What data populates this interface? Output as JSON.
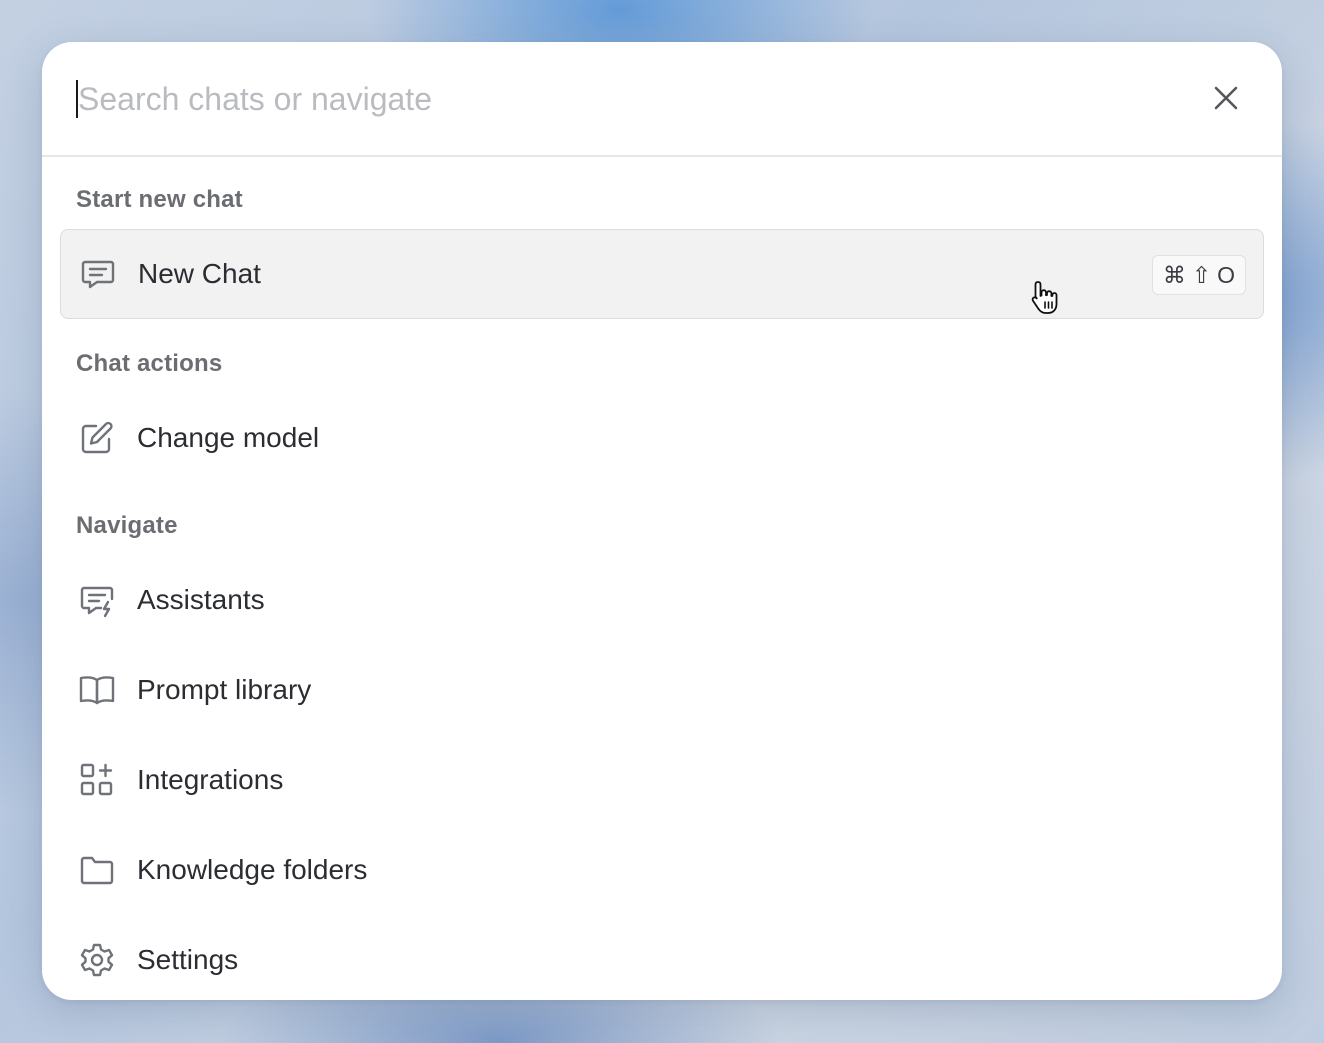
{
  "search": {
    "placeholder": "Search chats or navigate",
    "value": ""
  },
  "close": {
    "icon": "close-icon"
  },
  "sections": {
    "start_new_chat": {
      "heading": "Start new chat",
      "items": [
        {
          "label": "New Chat",
          "icon": "chat-bubble-icon",
          "shortcut": [
            "⌘",
            "⇧",
            "O"
          ],
          "highlighted": true
        }
      ]
    },
    "chat_actions": {
      "heading": "Chat actions",
      "items": [
        {
          "label": "Change model",
          "icon": "edit-pencil-icon"
        }
      ]
    },
    "navigate": {
      "heading": "Navigate",
      "items": [
        {
          "label": "Assistants",
          "icon": "chat-lightning-icon"
        },
        {
          "label": "Prompt library",
          "icon": "open-book-icon"
        },
        {
          "label": "Integrations",
          "icon": "grid-plus-icon"
        },
        {
          "label": "Knowledge folders",
          "icon": "folder-icon"
        },
        {
          "label": "Settings",
          "icon": "gear-icon"
        }
      ]
    }
  },
  "colors": {
    "highlight_bg": "#f2f2f3",
    "heading_text": "#6b6d72",
    "item_text": "#2b2d33",
    "icon_stroke": "#6f7278",
    "placeholder": "#b9bbc0"
  }
}
